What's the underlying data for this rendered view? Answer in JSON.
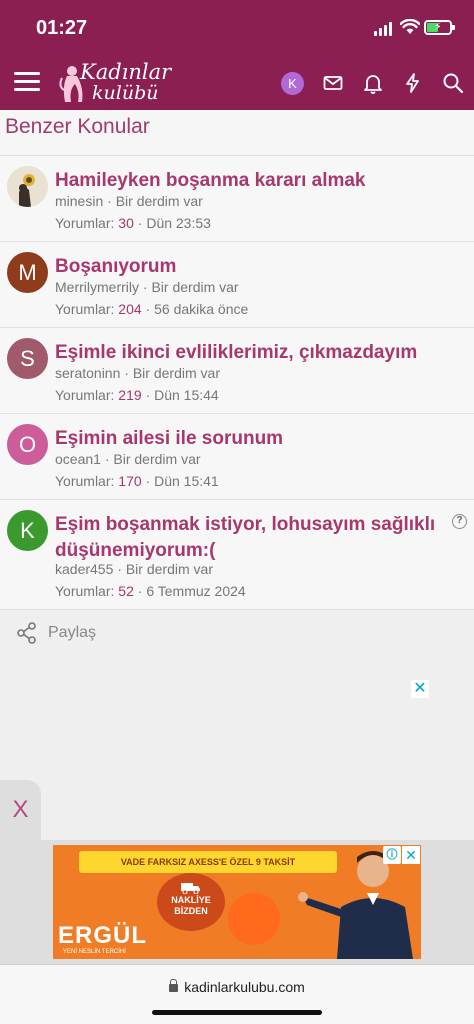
{
  "status_bar": {
    "time": "01:27"
  },
  "header": {
    "logo_line1": "Kadınlar",
    "logo_line2": "kulübü",
    "user_initial": "K"
  },
  "section": {
    "title": "Benzer Konular"
  },
  "threads": [
    {
      "title": "Hamileyken boşanma kararı almak",
      "author": "minesin",
      "forum": "Bir derdim var",
      "replies_label": "Yorumlar:",
      "replies": "30",
      "date": "Dün 23:53",
      "avatar_letter": "",
      "avatar_color": "#e9e2d2"
    },
    {
      "title": "Boşanıyorum",
      "author": "Merrilymerrily",
      "forum": "Bir derdim var",
      "replies_label": "Yorumlar:",
      "replies": "204",
      "date": "56 dakika önce",
      "avatar_letter": "M",
      "avatar_color": "#8e3c1c"
    },
    {
      "title": "Eşimle ikinci evliliklerimiz, çıkmazdayım",
      "author": "seratoninn",
      "forum": "Bir derdim var",
      "replies_label": "Yorumlar:",
      "replies": "219",
      "date": "Dün 15:44",
      "avatar_letter": "S",
      "avatar_color": "#a05a6c"
    },
    {
      "title": "Eşimin ailesi ile sorunum",
      "author": "ocean1",
      "forum": "Bir derdim var",
      "replies_label": "Yorumlar:",
      "replies": "170",
      "date": "Dün 15:41",
      "avatar_letter": "O",
      "avatar_color": "#cc5c9a"
    },
    {
      "title": "Eşim boşanmak istiyor, lohusayım sağlıklı düşünemiyorum:(",
      "author": "kader455",
      "forum": "Bir derdim var",
      "replies_label": "Yorumlar:",
      "replies": "52",
      "date": "6 Temmuz 2024",
      "avatar_letter": "K",
      "avatar_color": "#3a9a2e",
      "help_icon": "?"
    }
  ],
  "share": {
    "label": "Paylaş"
  },
  "ad": {
    "close_symbol": "✕",
    "side_tab_symbol": "X",
    "banner_text": "VADE FARKSIZ AXESS'E ÖZEL 9 TAKSİT",
    "badge_text": "NAKLİYE BİZDEN",
    "brand": "ERGÜL",
    "tagline": "YENİ NESLİN TERCİHİ",
    "info_symbol": "ⓘ",
    "banner_close_symbol": "✕",
    "orange": "#f07d26",
    "yellow": "#ffd62e"
  },
  "browser": {
    "url": "kadinlarkulubu.com"
  },
  "colors": {
    "brand": "#8c1f52",
    "link": "#a7386d"
  }
}
